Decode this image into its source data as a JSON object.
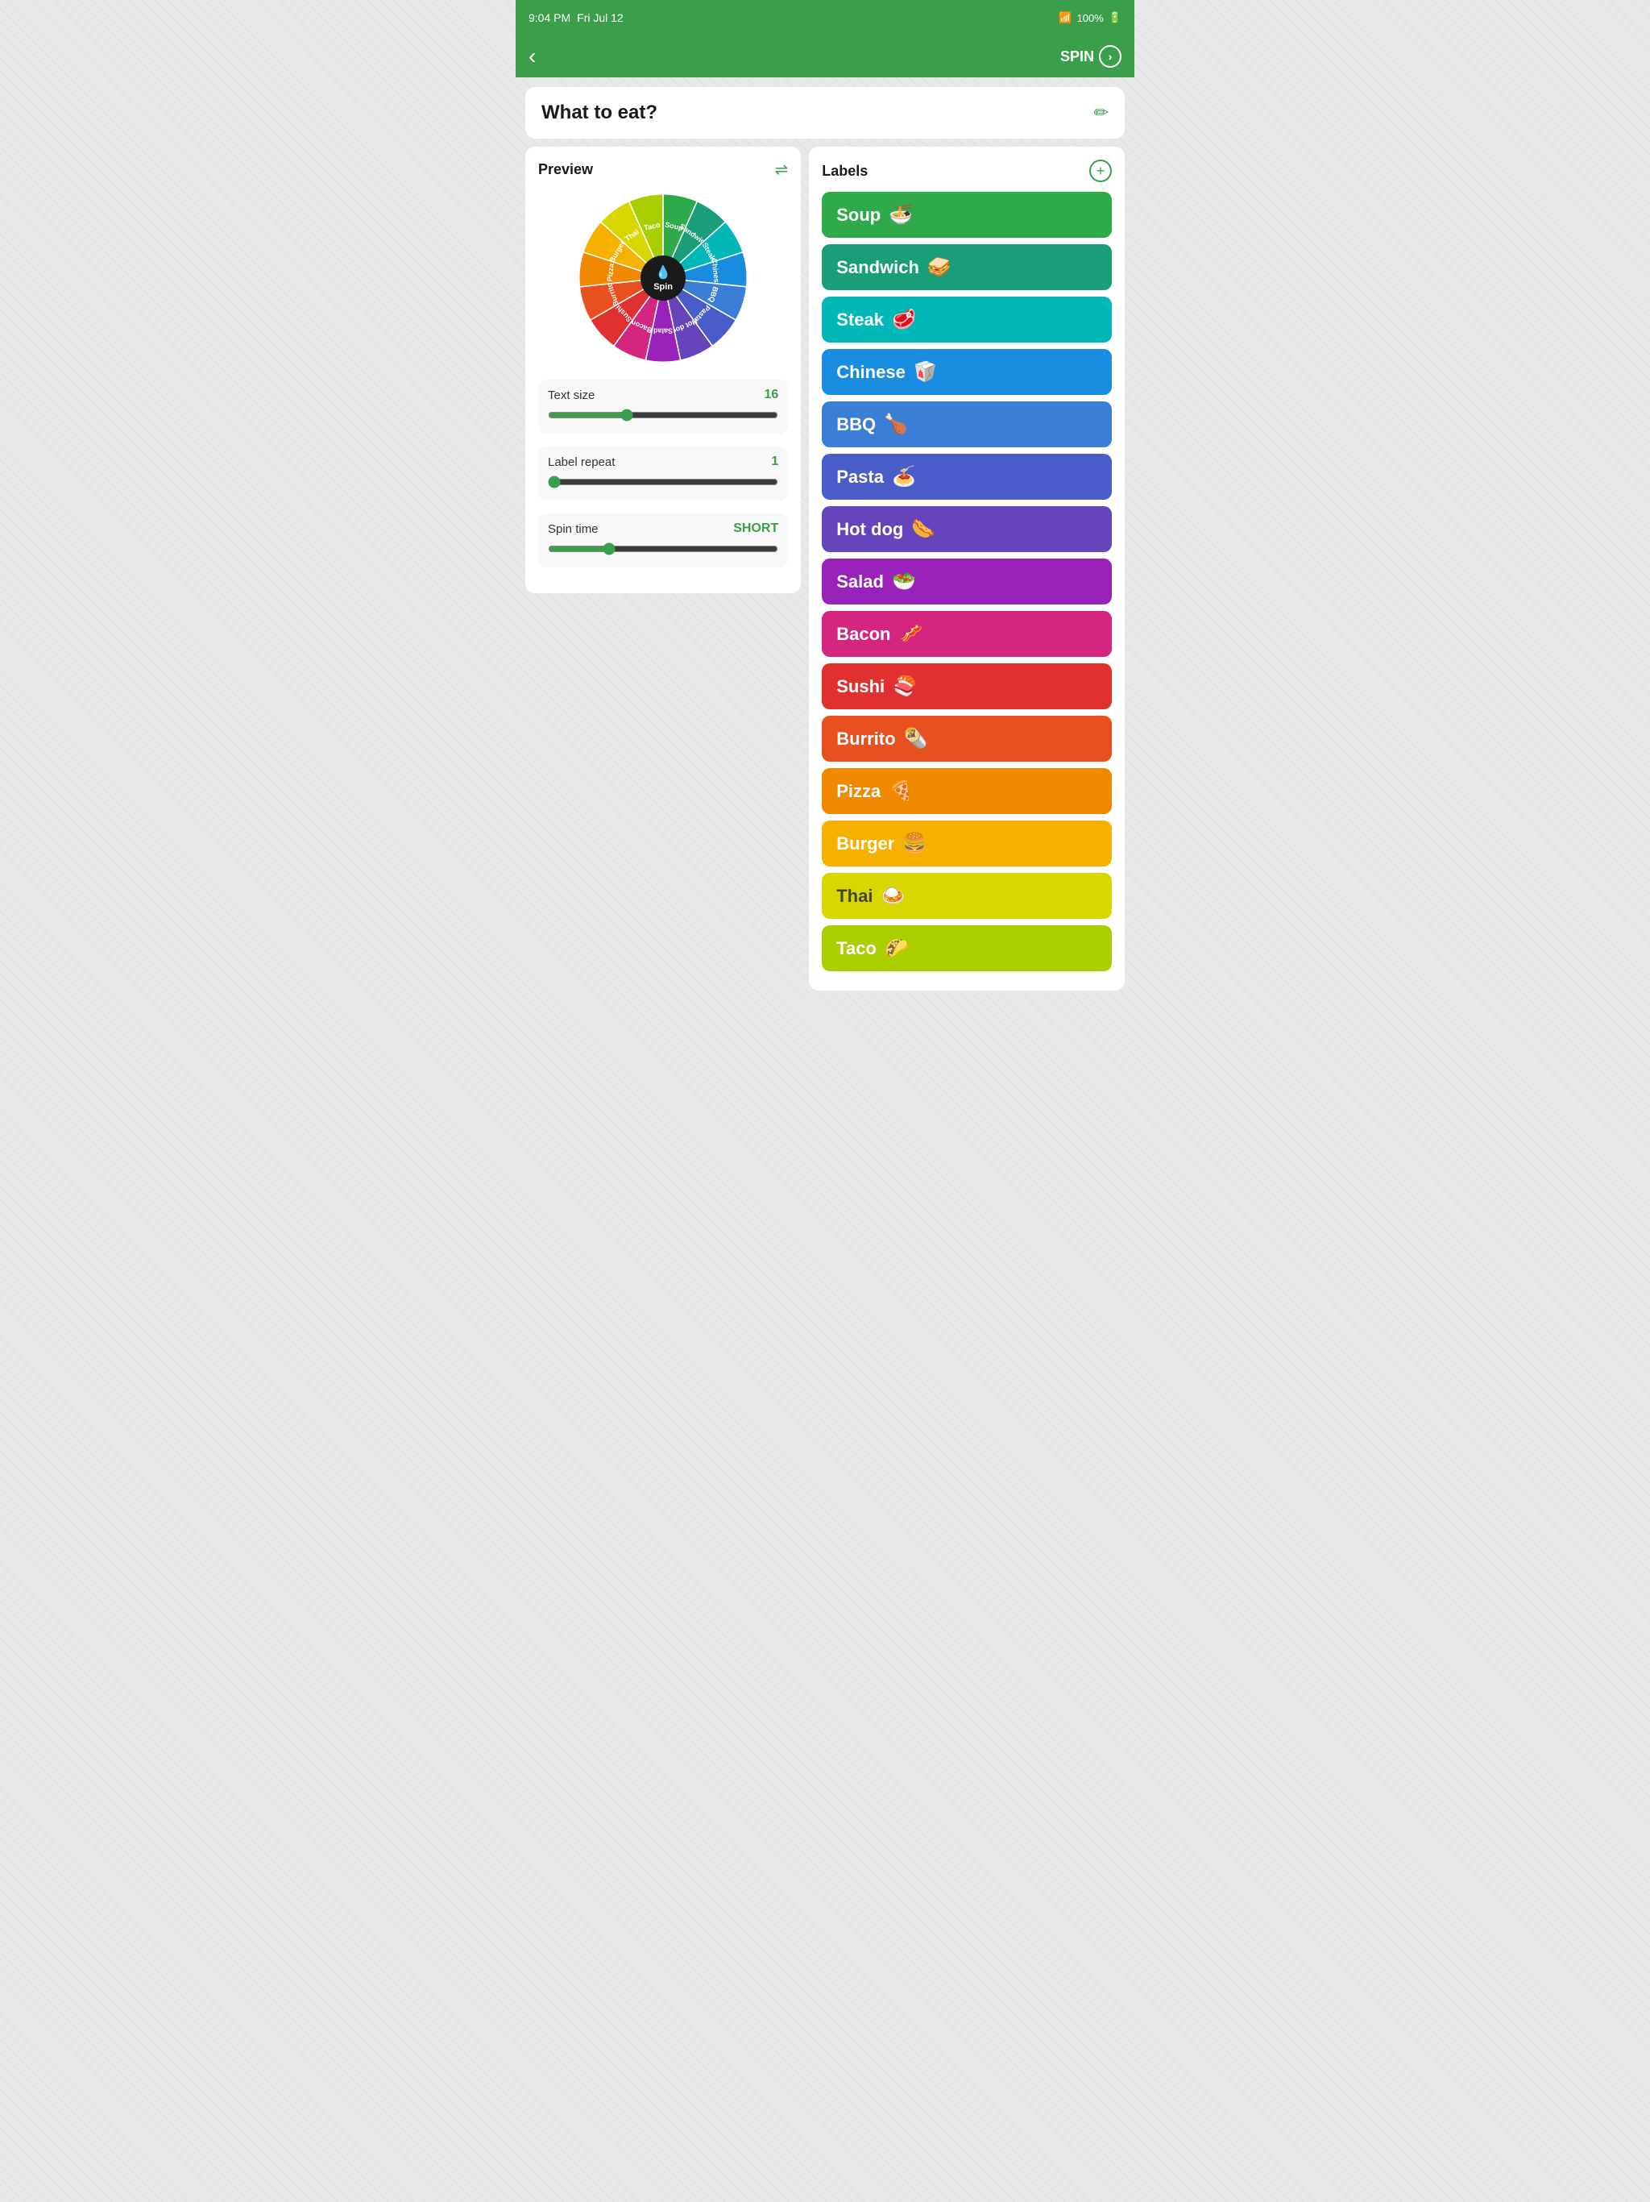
{
  "status_bar": {
    "time": "9:04 PM",
    "date": "Fri Jul 12",
    "wifi": "wifi",
    "battery": "100%"
  },
  "nav": {
    "back_label": "‹",
    "spin_label": "SPIN",
    "spin_arrow": "›"
  },
  "title_card": {
    "title": "What to eat?",
    "edit_icon": "✏"
  },
  "left_panel": {
    "preview_label": "Preview",
    "shuffle_icon": "⇌",
    "text_size_label": "Text size",
    "text_size_value": "16",
    "label_repeat_label": "Label repeat",
    "label_repeat_value": "1",
    "spin_time_label": "Spin time",
    "spin_time_value": "SHORT",
    "spin_button_label": "Spin"
  },
  "right_panel": {
    "labels_label": "Labels",
    "add_icon": "+",
    "items": [
      {
        "name": "Soup",
        "emoji": "🍜",
        "class": "btn-soup"
      },
      {
        "name": "Sandwich",
        "emoji": "🥪",
        "class": "btn-sandwich"
      },
      {
        "name": "Steak",
        "emoji": "🥩",
        "class": "btn-steak"
      },
      {
        "name": "Chinese",
        "emoji": "🥡",
        "class": "btn-chinese"
      },
      {
        "name": "BBQ",
        "emoji": "🍗",
        "class": "btn-bbq"
      },
      {
        "name": "Pasta",
        "emoji": "🍝",
        "class": "btn-pasta"
      },
      {
        "name": "Hot dog",
        "emoji": "🌭",
        "class": "btn-hotdog"
      },
      {
        "name": "Salad",
        "emoji": "🥗",
        "class": "btn-salad"
      },
      {
        "name": "Bacon",
        "emoji": "🥓",
        "class": "btn-bacon"
      },
      {
        "name": "Sushi",
        "emoji": "🍣",
        "class": "btn-sushi"
      },
      {
        "name": "Burrito",
        "emoji": "🌯",
        "class": "btn-burrito"
      },
      {
        "name": "Pizza",
        "emoji": "🍕",
        "class": "btn-pizza"
      },
      {
        "name": "Burger",
        "emoji": "🍔",
        "class": "btn-burger"
      },
      {
        "name": "Thai",
        "emoji": "🍛",
        "class": "btn-thai"
      },
      {
        "name": "Taco",
        "emoji": "🌮",
        "class": "btn-taco"
      }
    ]
  },
  "wheel": {
    "segments": [
      {
        "label": "Soup",
        "color": "#2eaa4a"
      },
      {
        "label": "Sandwich",
        "color": "#1a9e7a"
      },
      {
        "label": "Steak",
        "color": "#00b8b8"
      },
      {
        "label": "Chinese",
        "color": "#1a8ce0"
      },
      {
        "label": "BBQ",
        "color": "#3a7fd5"
      },
      {
        "label": "Pasta",
        "color": "#4a5cc8"
      },
      {
        "label": "Hot dog",
        "color": "#6644bb"
      },
      {
        "label": "Salad",
        "color": "#9922bb"
      },
      {
        "label": "Bacon",
        "color": "#d4267e"
      },
      {
        "label": "Sushi",
        "color": "#e03030"
      },
      {
        "label": "Burrito",
        "color": "#e85020"
      },
      {
        "label": "Pizza",
        "color": "#f08800"
      },
      {
        "label": "Burger",
        "color": "#f5b000"
      },
      {
        "label": "Thai",
        "color": "#d8d800"
      },
      {
        "label": "Taco",
        "color": "#aacf00"
      }
    ]
  }
}
